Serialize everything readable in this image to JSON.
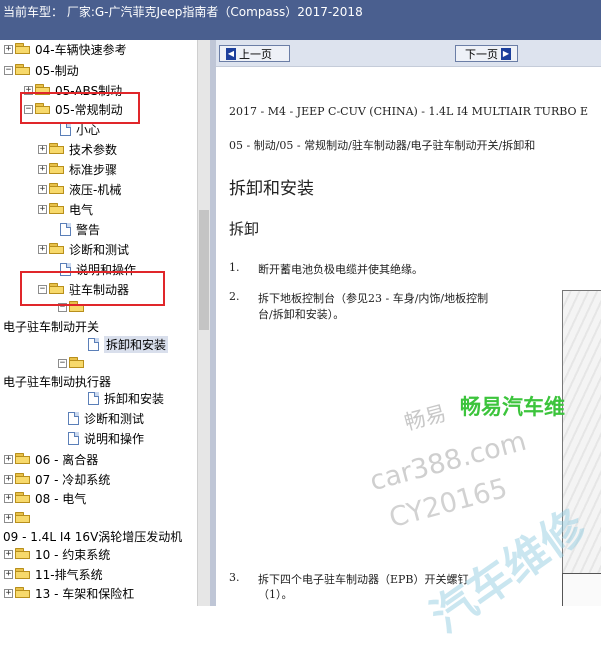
{
  "window": {
    "title": "当前车型： 厂家:G-广汽菲克Jeep指南者（Compass）2017-2018"
  },
  "tree": {
    "items": [
      {
        "id": "t1",
        "label": "04-车辆快速参考",
        "type": "folder",
        "expander": "+"
      },
      {
        "id": "t2",
        "label": "05-制动",
        "type": "folder",
        "expander": "−"
      },
      {
        "id": "t3",
        "label": "05-ABS制动",
        "type": "folder",
        "expander": "+"
      },
      {
        "id": "t4",
        "label": "05-常规制动",
        "type": "folder",
        "expander": "−"
      },
      {
        "id": "t5",
        "label": "小心",
        "type": "doc"
      },
      {
        "id": "t6",
        "label": "技术参数",
        "type": "folder",
        "expander": "+"
      },
      {
        "id": "t7",
        "label": "标准步骤",
        "type": "folder",
        "expander": "+"
      },
      {
        "id": "t8",
        "label": "液压-机械",
        "type": "folder",
        "expander": "+"
      },
      {
        "id": "t9",
        "label": "电气",
        "type": "folder",
        "expander": "+"
      },
      {
        "id": "t10",
        "label": "警告",
        "type": "doc"
      },
      {
        "id": "t11",
        "label": "诊断和测试",
        "type": "folder",
        "expander": "+"
      },
      {
        "id": "t12",
        "label": "说明和操作",
        "type": "doc"
      },
      {
        "id": "t13",
        "label": "驻车制动器",
        "type": "folder",
        "expander": "−"
      },
      {
        "id": "t14",
        "label": "",
        "type": "folder",
        "expander": "−"
      },
      {
        "id": "t15",
        "label": "电子驻车制动开关",
        "type": "text"
      },
      {
        "id": "t16",
        "label": "拆卸和安装",
        "type": "doc",
        "selected": true
      },
      {
        "id": "t17",
        "label": "",
        "type": "folder",
        "expander": "−"
      },
      {
        "id": "t18",
        "label": "电子驻车制动执行器",
        "type": "text"
      },
      {
        "id": "t19",
        "label": "拆卸和安装",
        "type": "doc"
      },
      {
        "id": "t20",
        "label": "诊断和测试",
        "type": "doc"
      },
      {
        "id": "t21",
        "label": "说明和操作",
        "type": "doc"
      },
      {
        "id": "t22",
        "label": "06 - 离合器",
        "type": "folder",
        "expander": "+"
      },
      {
        "id": "t23",
        "label": "07 - 冷却系统",
        "type": "folder",
        "expander": "+"
      },
      {
        "id": "t24",
        "label": "08 - 电气",
        "type": "folder",
        "expander": "+"
      },
      {
        "id": "t25",
        "label": "",
        "type": "folder",
        "expander": "+"
      },
      {
        "id": "t26",
        "label": "09 - 1.4L I4 16V涡轮增压发动机",
        "type": "text"
      },
      {
        "id": "t27",
        "label": "10 - 约束系统",
        "type": "folder",
        "expander": "+"
      },
      {
        "id": "t28",
        "label": "11-排气系统",
        "type": "folder",
        "expander": "+"
      },
      {
        "id": "t29",
        "label": "13 - 车架和保险杠",
        "type": "folder",
        "expander": "+"
      }
    ]
  },
  "nav": {
    "prev_label": "上一页",
    "next_label": "下一页"
  },
  "doc": {
    "vehicle_line": "2017 - M4 - JEEP C-CUV (CHINA) - 1.4L I4 MULTIAIR TURBO E",
    "breadcrumb": "05 - 制动/05 - 常规制动/驻车制动器/电子驻车制动开关/拆卸和",
    "heading": "拆卸和安装",
    "subheading": "拆卸",
    "step1_num": "1.",
    "step1": "断开蓄电池负极电缆并使其绝缘。",
    "step2_num": "2.",
    "step2_a": "拆下地板控制台（参见23 - 车身/内饰/地板控制",
    "step2_b": "台/拆卸和安装）。",
    "step3_num": "3.",
    "step3_a": "拆下四个电子驻车制动器（EPB）开关螺钉",
    "step3_b": "（1）。"
  },
  "watermark": {
    "brand": "畅易汽车维",
    "brand_grey": "畅易",
    "site": "car388.com",
    "code": "CY20165",
    "brand_bottom": "汽车维修"
  },
  "colors": {
    "titlebar": "#4a5f8f",
    "highlight": "#e0262a",
    "watermark_green": "#3cc43c"
  }
}
